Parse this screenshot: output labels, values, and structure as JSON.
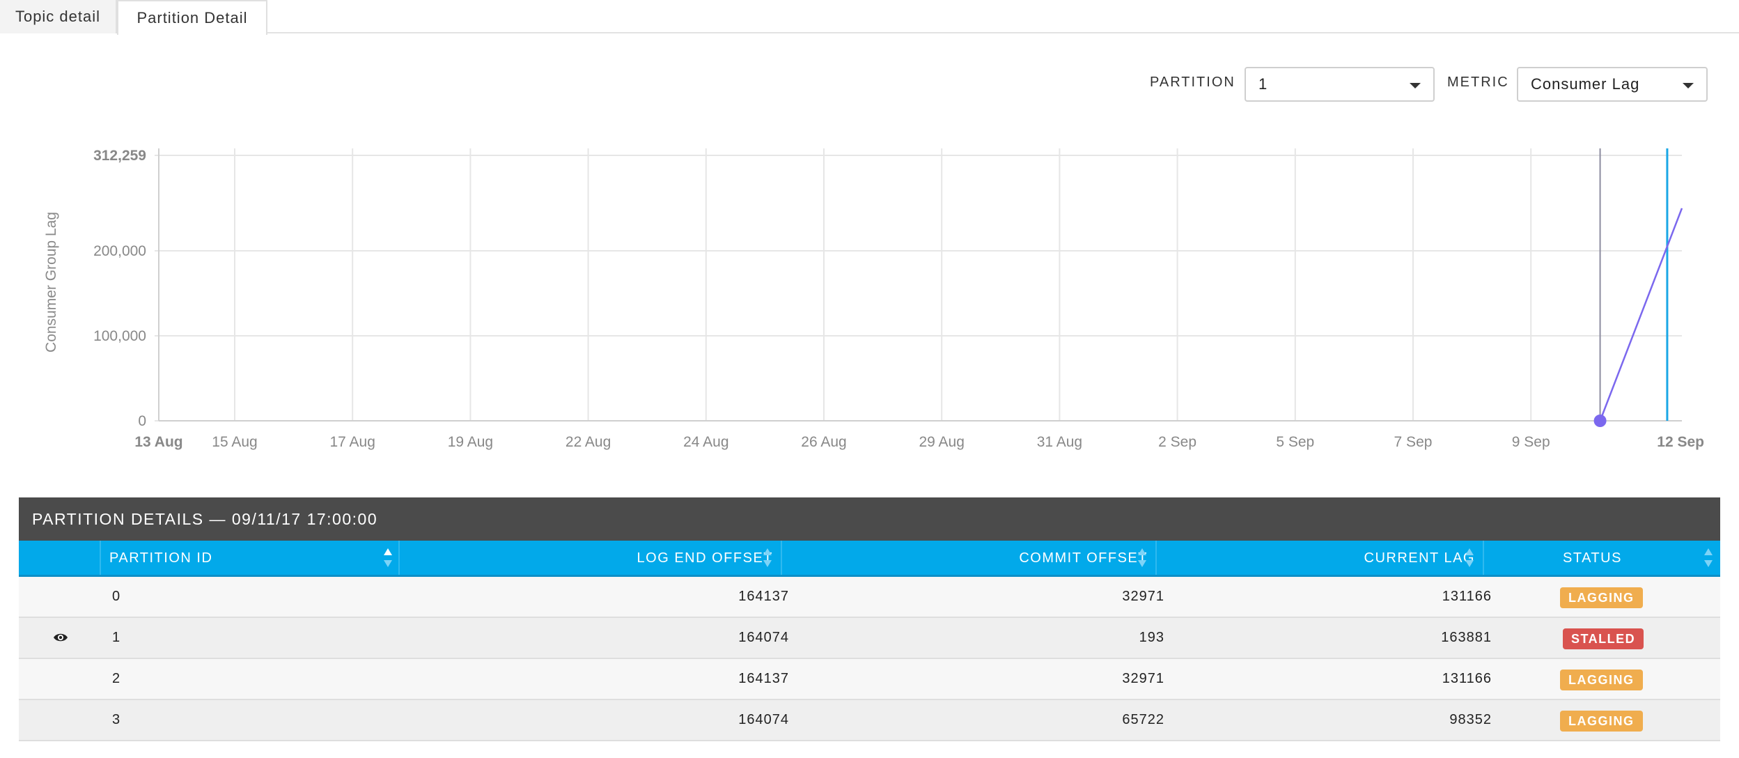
{
  "tabs": [
    {
      "label": "Topic detail",
      "active": false
    },
    {
      "label": "Partition Detail",
      "active": true
    }
  ],
  "controls": {
    "partition_label": "PARTITION",
    "partition_value": "1",
    "metric_label": "METRIC",
    "metric_value": "Consumer Lag"
  },
  "chart_data": {
    "type": "line",
    "ylabel": "Consumer Group Lag",
    "ylim": [
      0,
      312259
    ],
    "y_ticks": [
      "312,259",
      "200,000",
      "100,000",
      "0"
    ],
    "x_ticks": [
      "13 Aug",
      "15 Aug",
      "17 Aug",
      "19 Aug",
      "22 Aug",
      "24 Aug",
      "26 Aug",
      "29 Aug",
      "31 Aug",
      "2 Sep",
      "5 Sep",
      "7 Sep",
      "9 Sep",
      "12 Sep"
    ],
    "xlim": [
      "2017-08-13",
      "2017-09-12"
    ],
    "grid": true,
    "series": [
      {
        "color": "#7b68ee",
        "points": [
          {
            "x": "2017-09-10 09:00",
            "y": 0
          },
          {
            "x": "2017-09-12 19:00",
            "y": 250000
          },
          {
            "x": "2017-09-12 23:00",
            "y": 250000
          }
        ]
      }
    ],
    "marker_x": "2017-09-10 09:00",
    "cursor_x": "2017-09-11 17:00",
    "colors": {
      "line": "#7b68ee",
      "marker_line": "#8c8ca0",
      "cursor": "#1aa7e6",
      "grid": "#e6e6e6"
    }
  },
  "table": {
    "title": "PARTITION DETAILS — 09/11/17 17:00:00",
    "columns": [
      "PARTITION ID",
      "LOG END OFFSET",
      "COMMIT OFFSET",
      "CURRENT LAG",
      "STATUS"
    ],
    "rows": [
      {
        "partition_id": "0",
        "log_end_offset": "164137",
        "commit_offset": "32971",
        "current_lag": "131166",
        "status": "LAGGING",
        "selected": false
      },
      {
        "partition_id": "1",
        "log_end_offset": "164074",
        "commit_offset": "193",
        "current_lag": "163881",
        "status": "STALLED",
        "selected": true
      },
      {
        "partition_id": "2",
        "log_end_offset": "164137",
        "commit_offset": "32971",
        "current_lag": "131166",
        "status": "LAGGING",
        "selected": false
      },
      {
        "partition_id": "3",
        "log_end_offset": "164074",
        "commit_offset": "65722",
        "current_lag": "98352",
        "status": "LAGGING",
        "selected": false
      }
    ],
    "status_colors": {
      "LAGGING": "#f0ad4e",
      "STALLED": "#d9534f"
    }
  }
}
